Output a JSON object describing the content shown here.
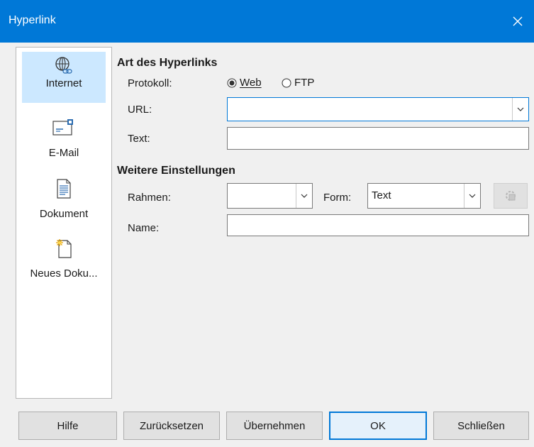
{
  "window": {
    "title": "Hyperlink",
    "close_glyph": "✕"
  },
  "sidebar": {
    "items": [
      {
        "label": "Internet",
        "icon": "globe-link-icon",
        "active": true
      },
      {
        "label": "E-Mail",
        "icon": "envelope-icon"
      },
      {
        "label": "Dokument",
        "icon": "document-icon"
      },
      {
        "label": "Neues Doku...",
        "icon": "new-document-icon"
      }
    ]
  },
  "hyperlink_type": {
    "heading": "Art des Hyperlinks",
    "protocol_label": "Protokoll:",
    "protocol_options": [
      {
        "label": "Web",
        "selected": true
      },
      {
        "label": "FTP",
        "selected": false
      }
    ],
    "url_label": "URL:",
    "url_value": "",
    "text_label": "Text:",
    "text_value": ""
  },
  "further_settings": {
    "heading": "Weitere Einstellungen",
    "frame_label": "Rahmen:",
    "frame_value": "",
    "form_label": "Form:",
    "form_value": "Text",
    "name_label": "Name:",
    "name_value": ""
  },
  "buttons": {
    "help": "Hilfe",
    "reset": "Zurücksetzen",
    "apply": "Übernehmen",
    "ok": "OK",
    "close": "Schließen"
  },
  "colors": {
    "titlebar": "#0078d7",
    "selection": "#cce8ff",
    "accent": "#0078d7"
  }
}
